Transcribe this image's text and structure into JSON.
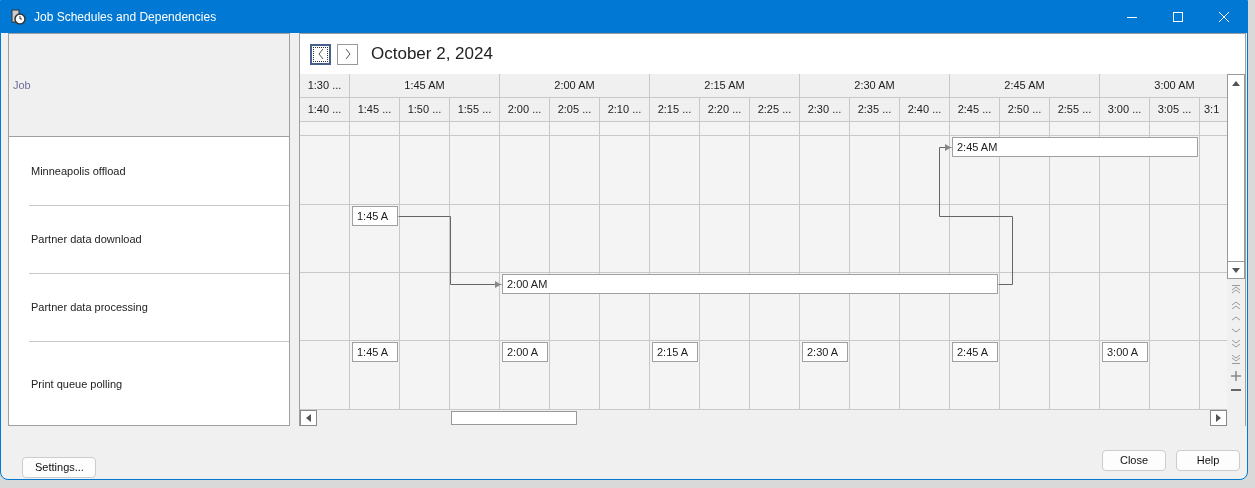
{
  "window": {
    "title": "Job Schedules and Dependencies"
  },
  "left_header": "Job",
  "calendar": {
    "date": "October 2, 2024",
    "nav_buttons": [
      {
        "kind": "prev",
        "focused": true
      },
      {
        "kind": "next",
        "focused": false
      }
    ]
  },
  "time_scale": {
    "major": [
      "1:30 ...",
      "1:45 AM",
      "2:00 AM",
      "2:15 AM",
      "2:30 AM",
      "2:45 AM",
      "3:00 AM"
    ],
    "minor": [
      "1:40 ...",
      "1:45 ...",
      "1:50 ...",
      "1:55 ...",
      "2:00 ...",
      "2:05 ...",
      "2:10 ...",
      "2:15 ...",
      "2:20 ...",
      "2:25 ...",
      "2:30 ...",
      "2:35 ...",
      "2:40 ...",
      "2:45 ...",
      "2:50 ...",
      "2:55 ...",
      "3:00 ...",
      "3:05 ...",
      "3:1"
    ]
  },
  "jobs": [
    {
      "name": "Minneapolis offload",
      "appointments": [
        {
          "label": "2:45 AM"
        }
      ]
    },
    {
      "name": "Partner data download",
      "appointments": [
        {
          "label": "1:45 A"
        }
      ]
    },
    {
      "name": "Partner data processing",
      "appointments": [
        {
          "label": "2:00 AM"
        }
      ]
    },
    {
      "name": "Print queue polling",
      "appointments": [
        {
          "label": "1:45 A"
        },
        {
          "label": "2:00 A"
        },
        {
          "label": "2:15 A"
        },
        {
          "label": "2:30 A"
        },
        {
          "label": "2:45 A"
        },
        {
          "label": "3:00 A"
        }
      ]
    }
  ],
  "footer": {
    "left_buttons": [
      "Settings..."
    ],
    "right_buttons": [
      "Close",
      "Help"
    ]
  }
}
